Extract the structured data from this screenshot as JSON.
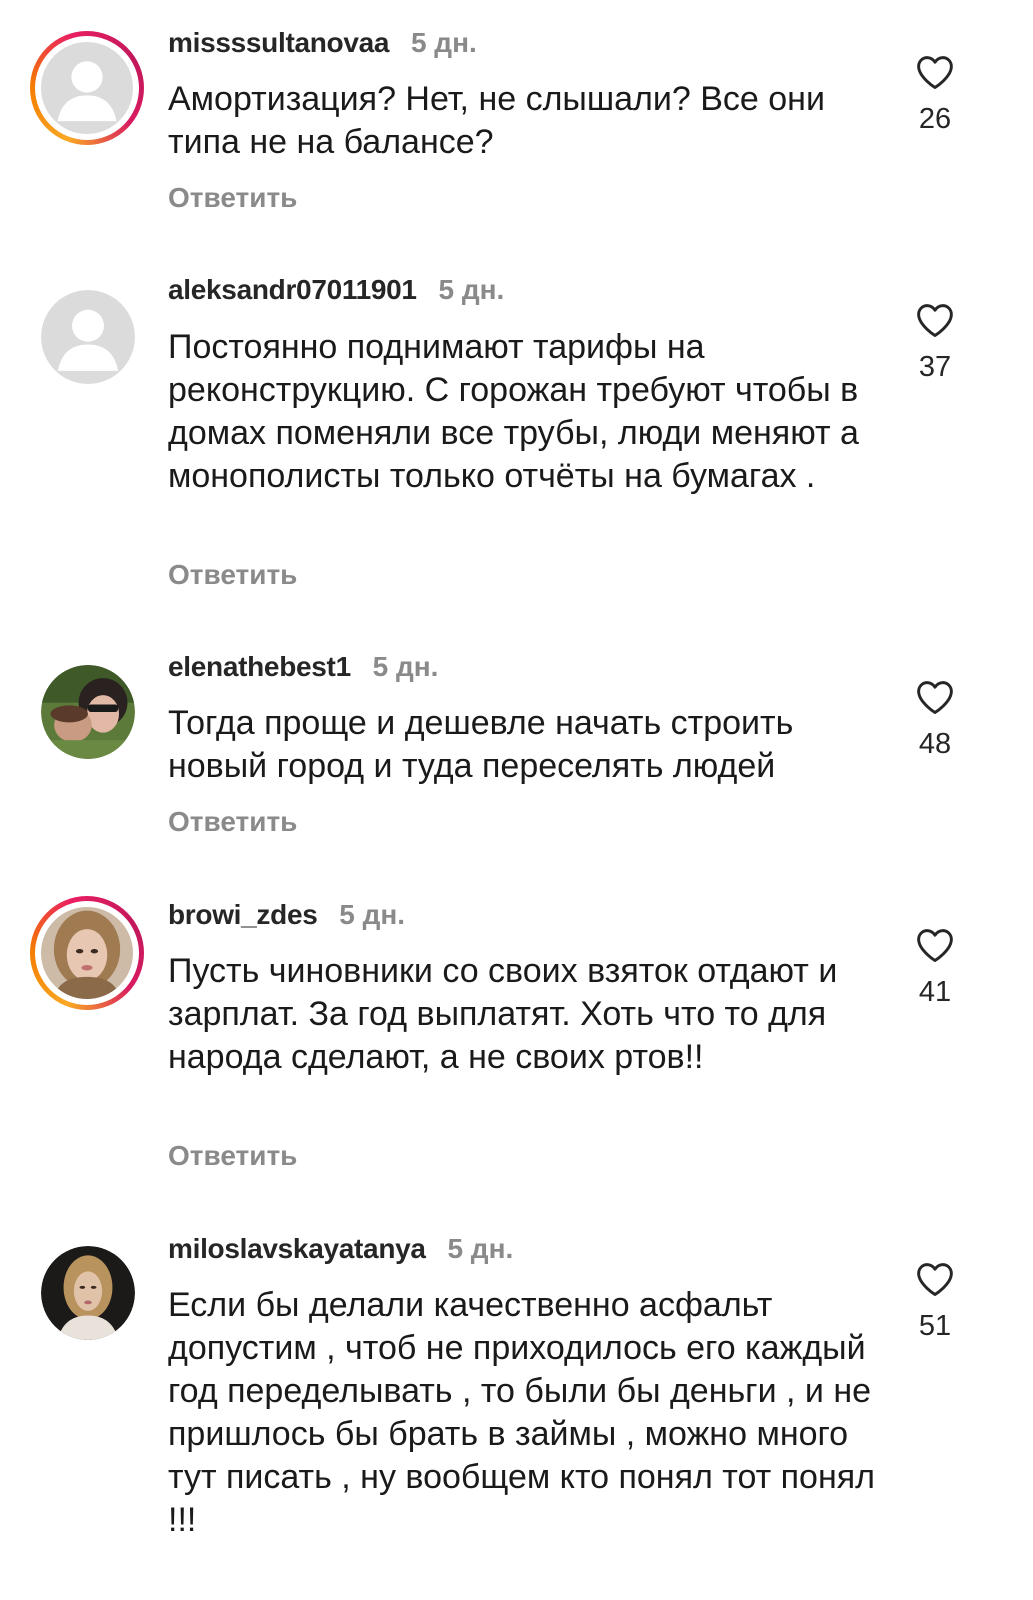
{
  "comments": [
    {
      "username": "missssultanovaa",
      "time": "5 дн.",
      "text": "Амортизация? Нет, не слышали? Все они типа не на балансе?",
      "likes": "26",
      "reply_label": "Ответить"
    },
    {
      "username": "aleksandr07011901",
      "time": "5 дн.",
      "text": "Постоянно поднимают тарифы на реконструкцию. С горожан требуют чтобы в домах поменяли все трубы, люди меняют а монополисты только отчёты на бумагах .",
      "likes": "37",
      "reply_label": "Ответить"
    },
    {
      "username": "elenathebest1",
      "time": "5 дн.",
      "text": "Тогда проще и дешевле начать строить новый город и туда переселять людей",
      "likes": "48",
      "reply_label": "Ответить"
    },
    {
      "username": "browi_zdes",
      "time": "5 дн.",
      "text": "Пусть чиновники со своих взяток отдают и зарплат. За год выплатят. Хоть что то для народа сделают, а не своих ртов!!",
      "likes": "41",
      "reply_label": "Ответить"
    },
    {
      "username": "miloslavskayatanya",
      "time": "5 дн.",
      "text": "Если бы делали качественно асфальт допустим , чтоб не приходилось его каждый год переделывать , то были бы деньги , и не пришлось бы брать в займы , можно много тут писать , ну вообщем кто понял тот понял !!!",
      "likes": "51"
    }
  ],
  "icons": {
    "like": "heart-outline-icon",
    "default_avatar": "default-avatar-icon"
  }
}
